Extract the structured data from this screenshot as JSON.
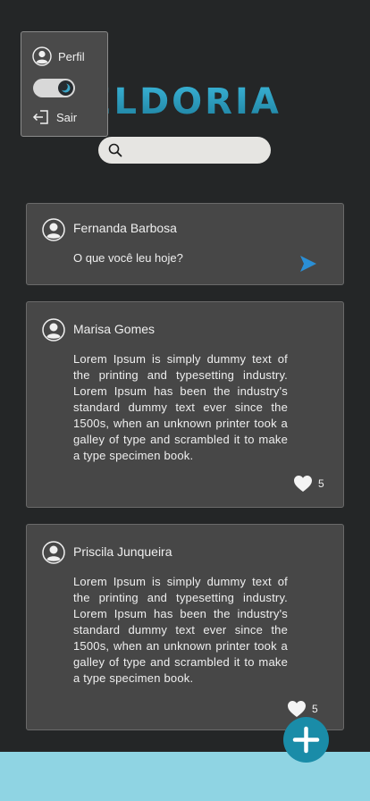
{
  "app": {
    "logo_text": "ELDORIA"
  },
  "menu": {
    "profile_label": "Perfil",
    "logout_label": "Sair",
    "dark_mode": true
  },
  "search": {
    "placeholder": ""
  },
  "composer": {
    "author": "Fernanda Barbosa",
    "prompt": "O que você leu hoje?"
  },
  "posts": [
    {
      "author": "Marisa Gomes",
      "text": "Lorem Ipsum is simply dummy text of the printing and typesetting industry. Lorem Ipsum has been the industry's standard dummy text ever since the 1500s, when an unknown printer took a galley of type and scrambled it to make a type specimen book.",
      "likes": "5"
    },
    {
      "author": "Priscila Junqueira",
      "text": "Lorem Ipsum is simply dummy text of the printing and typesetting industry. Lorem Ipsum has been the industry's standard dummy text ever since the 1500s, when an unknown printer took a galley of type and scrambled it to make a type specimen book.",
      "likes": "5"
    }
  ],
  "colors": {
    "background": "#242627",
    "card": "#474747",
    "accent": "#1a8ca8",
    "logo": "#2a9fbf",
    "bottom_bar": "#8fd4e3",
    "send": "#2a8fd6"
  },
  "icons": {
    "profile": "user-circle-icon",
    "logout": "logout-icon",
    "search": "search-icon",
    "send": "send-icon",
    "like": "heart-icon",
    "add": "plus-icon"
  }
}
